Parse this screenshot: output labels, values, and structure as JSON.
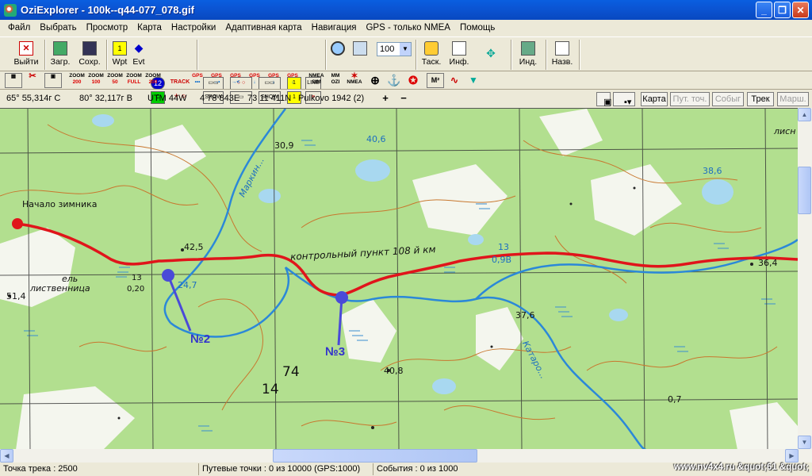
{
  "window": {
    "title": "OziExplorer - 100k--q44-077_078.gif",
    "min": "_",
    "max": "❐",
    "close": "✕"
  },
  "menu": [
    "Файл",
    "Выбрать",
    "Просмотр",
    "Карта",
    "Настройки",
    "Адаптивная карта",
    "Навигация",
    "GPS - только NMEA",
    "Помощь"
  ],
  "toolbar1": {
    "exit": "Выйти",
    "load": "Загр.",
    "save": "Сохр.",
    "wpt": "Wpt",
    "evt": "Evt",
    "num12": "12",
    "track": "TRACK",
    "show": "SHOW",
    "line": "LINE",
    "zoom_value": "100",
    "plus": "+",
    "minus": "−",
    "task": "Таск.",
    "info": "Инф.",
    "ind": "Инд.",
    "name": "Назв."
  },
  "toolbar2": {
    "zoom_buttons": [
      {
        "l1": "ZOOM",
        "l2": "200"
      },
      {
        "l1": "ZOOM",
        "l2": "100"
      },
      {
        "l1": "ZOOM",
        "l2": "50"
      },
      {
        "l1": "ZOOM",
        "l2": "FULL"
      },
      {
        "l1": "ZOOM",
        "l2": "200"
      }
    ],
    "gps_buttons": [
      {
        "l1": "GPS",
        "l2": "•••"
      },
      {
        "l1": "GPS",
        "l2": "→•"
      },
      {
        "l1": "GPS",
        "l2": "→<"
      },
      {
        "l1": "GPS",
        "l2": "↓"
      },
      {
        "l1": "GPS",
        "l2": "↓"
      },
      {
        "l1": "GPS",
        "l2": "↓"
      }
    ],
    "nmea_sim": {
      "l1": "NMEA",
      "l2": "SIM"
    },
    "mm_ozi": {
      "l1": "MM",
      "l2": "OZI"
    },
    "nmea": "NMEA",
    "m2": "M²"
  },
  "coords": {
    "lat": "65° 55,314г С",
    "lon": "80° 32,117г В",
    "utm": "UTM  44W",
    "easting": "4 78 843E",
    "northing": "73 11 411N",
    "datum": "Pulkovo 1942 (2)"
  },
  "view_buttons": [
    "Карта",
    "Пут. точ.",
    "Собыг",
    "Трек",
    "Марш."
  ],
  "map": {
    "labels": {
      "start": "Начало зимника",
      "checkpoint": "контрольный пункт 108 й км",
      "el": "ель",
      "listv": "лиственница",
      "frac_top": "13",
      "frac_bot": "0,20",
      "river1": "Маркин...",
      "river2": "Катаро...",
      "h425": "42,5",
      "h247": "24,7",
      "h514": "51,4",
      "h309": "30,9",
      "h406": "40,6",
      "h386": "38,6",
      "h376": "37,6",
      "h364": "36,4",
      "h408": "40,8",
      "h07": "0,7",
      "n13": "13",
      "n09b": "0,9B",
      "n74": "74",
      "n14": "14",
      "lisn": "лисн"
    },
    "waypoints": [
      "№2",
      "№3"
    ]
  },
  "status": {
    "track_points": "Точка трека : 2500",
    "waypoints": "Путевые точки : 0 из 10000  (GPS:1000)",
    "events": "События : 0 из 1000",
    "watermark": "www.nv4x4.ru &quot;61 &quot;"
  }
}
